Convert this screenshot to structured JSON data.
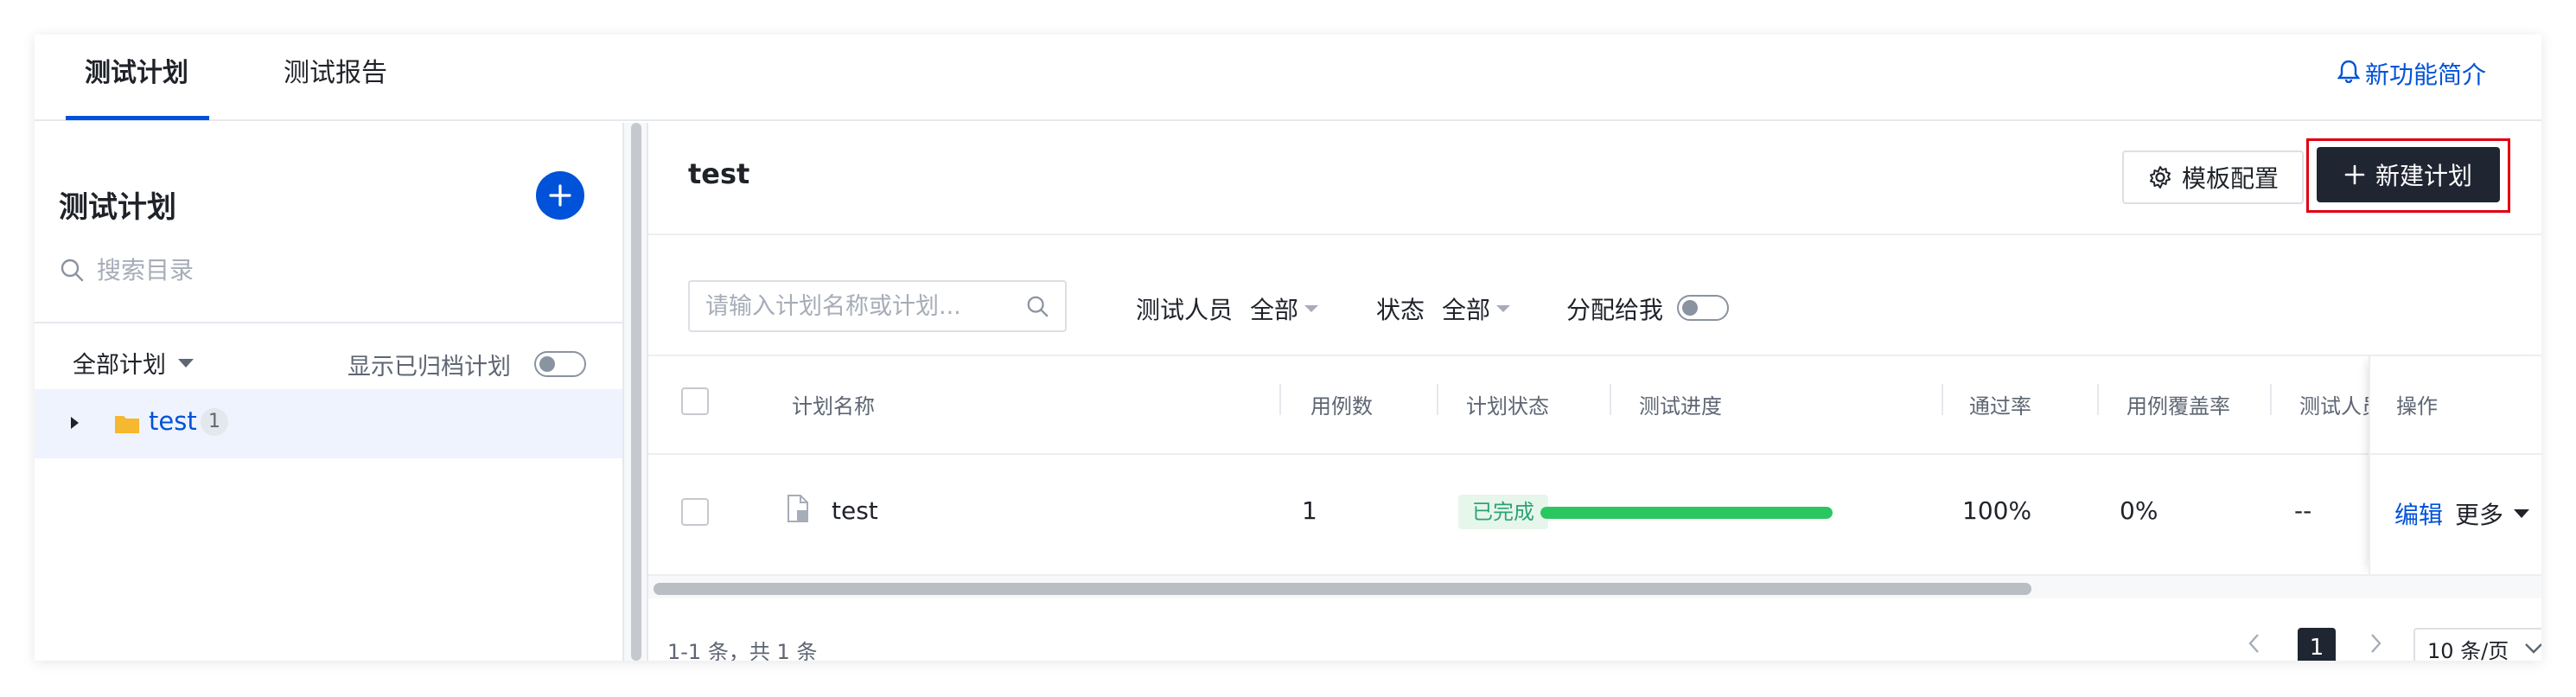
{
  "tabs": [
    {
      "label": "测试计划",
      "active": true
    },
    {
      "label": "测试报告",
      "active": false
    }
  ],
  "feature_link": "新功能简介",
  "sidebar": {
    "title": "测试计划",
    "search_placeholder": "搜索目录",
    "filter_label": "全部计划",
    "show_archived_label": "显示已归档计划",
    "tree": [
      {
        "label": "test",
        "count": "1"
      }
    ]
  },
  "main": {
    "title": "test",
    "template_button": "模板配置",
    "new_button": "新建计划",
    "search_placeholder": "请输入计划名称或计划...",
    "filters": {
      "tester_label": "测试人员",
      "tester_value": "全部",
      "status_label": "状态",
      "status_value": "全部",
      "assigned_label": "分配给我"
    },
    "table": {
      "columns": [
        "计划名称",
        "用例数",
        "计划状态",
        "测试进度",
        "通过率",
        "用例覆盖率",
        "测试人员",
        "操作"
      ],
      "rows": [
        {
          "name": "test",
          "case_count": "1",
          "status": "已完成",
          "progress": 1.0,
          "pass_rate": "100%",
          "coverage": "0%",
          "tester": "--",
          "actions": {
            "edit": "编辑",
            "more": "更多"
          }
        }
      ]
    },
    "pagination": {
      "total_text": "1-1 条，共 1 条",
      "current_page": "1",
      "page_size": "10 条/页"
    }
  },
  "colors": {
    "accent": "#0052d9",
    "primary_dark": "#1f2632",
    "success": "#2ac760",
    "highlight_border": "#e0000f"
  }
}
